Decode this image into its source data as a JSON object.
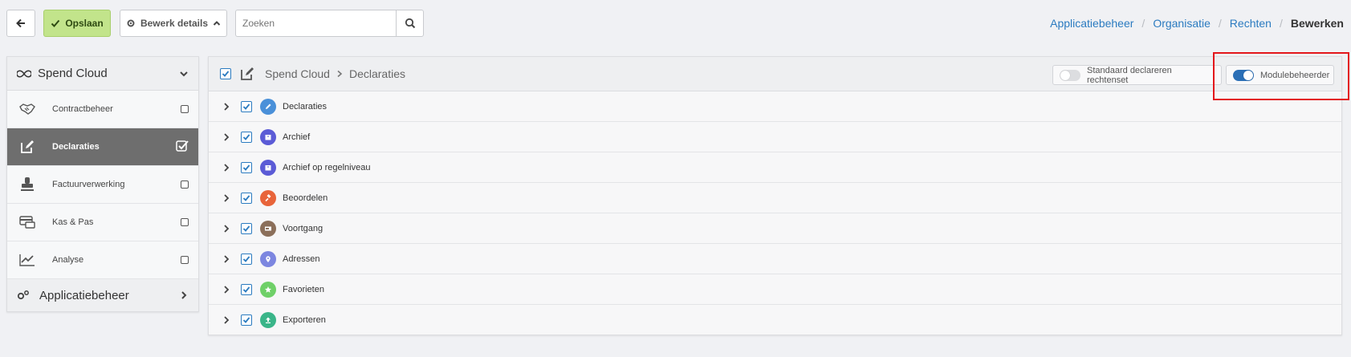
{
  "toolbar": {
    "back_icon": "arrow-left-icon",
    "save_label": "Opslaan",
    "details_label": "Bewerk details",
    "search_placeholder": "Zoeken"
  },
  "breadcrumb": {
    "items": [
      "Applicatiebeheer",
      "Organisatie",
      "Rechten"
    ],
    "current": "Bewerken",
    "separator": "/"
  },
  "sidebar": {
    "header": "Spend Cloud",
    "items": [
      {
        "label": "Contractbeheer",
        "icon": "handshake-icon",
        "checked": false
      },
      {
        "label": "Declaraties",
        "icon": "edit-icon",
        "checked": true,
        "active": true
      },
      {
        "label": "Factuurverwerking",
        "icon": "stamp-icon",
        "checked": false
      },
      {
        "label": "Kas & Pas",
        "icon": "card-icon",
        "checked": false
      },
      {
        "label": "Analyse",
        "icon": "chart-icon",
        "checked": false
      }
    ],
    "footer": "Applicatiebeheer"
  },
  "panel": {
    "path_root": "Spend Cloud",
    "path_leaf": "Declaraties",
    "toggle_default": "Standaard declareren rechtenset",
    "toggle_module": "Modulebeheerder",
    "rows": [
      {
        "label": "Declaraties",
        "color": "#4a90d9",
        "icon": "pencil-icon"
      },
      {
        "label": "Archief",
        "color": "#5b5bd6",
        "icon": "archive-icon"
      },
      {
        "label": "Archief op regelniveau",
        "color": "#5b5bd6",
        "icon": "archive-icon"
      },
      {
        "label": "Beoordelen",
        "color": "#e8643a",
        "icon": "gavel-icon"
      },
      {
        "label": "Voortgang",
        "color": "#8b6f5a",
        "icon": "progress-icon"
      },
      {
        "label": "Adressen",
        "color": "#7c86e0",
        "icon": "location-icon"
      },
      {
        "label": "Favorieten",
        "color": "#6fd068",
        "icon": "star-icon"
      },
      {
        "label": "Exporteren",
        "color": "#3ab589",
        "icon": "upload-icon"
      }
    ]
  },
  "colors": {
    "accent": "#2b7bc0",
    "save_bg": "#c2e48b",
    "highlight": "#e3161b"
  }
}
